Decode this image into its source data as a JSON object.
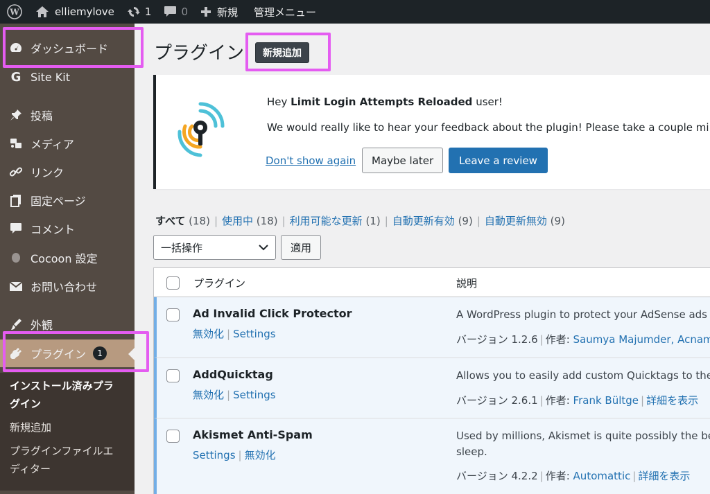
{
  "adminbar": {
    "site_name": "elliemylove",
    "updates_count": "1",
    "comments_count": "0",
    "new_label": "新規",
    "admin_menu_label": "管理メニュー"
  },
  "sidebar": {
    "items": [
      {
        "label": "ダッシュボード",
        "icon": "dashboard-icon"
      },
      {
        "label": "Site Kit",
        "icon": "google-g-icon"
      },
      {
        "label": "投稿",
        "icon": "pin-icon"
      },
      {
        "label": "メディア",
        "icon": "media-icon"
      },
      {
        "label": "リンク",
        "icon": "link-icon"
      },
      {
        "label": "固定ページ",
        "icon": "pages-icon"
      },
      {
        "label": "コメント",
        "icon": "comment-icon"
      },
      {
        "label": "Cocoon 設定",
        "icon": "circle-icon"
      },
      {
        "label": "お問い合わせ",
        "icon": "mail-icon"
      },
      {
        "label": "外観",
        "icon": "brush-icon"
      },
      {
        "label": "プラグイン",
        "icon": "plugin-icon",
        "badge": "1"
      }
    ],
    "submenu": {
      "installed_line1": "インストール済みプラ",
      "installed_line2": "グイン",
      "add_new": "新規追加",
      "editor_line1": "プラグインファイルエ",
      "editor_line2": "ディター"
    }
  },
  "main": {
    "title": "プラグイン",
    "add_new_button": "新規追加"
  },
  "notice": {
    "greeting_pre": "Hey ",
    "plugin_name": "Limit Login Attempts Reloaded",
    "greeting_post": " user!",
    "message": "We would really like to hear your feedback about the plugin! Please take a couple minute",
    "dont_show": "Don't show again",
    "maybe_later": "Maybe later",
    "leave_review": "Leave a review"
  },
  "filters": {
    "all": "すべて",
    "all_count": "(18)",
    "active": "使用中",
    "active_count": "(18)",
    "updates": "利用可能な更新",
    "updates_count": "(1)",
    "auto_on": "自動更新有効",
    "auto_on_count": "(9)",
    "auto_off": "自動更新無効",
    "auto_off_count": "(9)",
    "sep": "|"
  },
  "bulk": {
    "select_value": "一括操作",
    "apply": "適用"
  },
  "table": {
    "col_plugin": "プラグイン",
    "col_desc": "説明",
    "rows": [
      {
        "name": "Ad Invalid Click Protector",
        "action1": "無効化",
        "action2": "Settings",
        "desc1": "A WordPress plugin to protect your AdSense ads f",
        "version": "バージョン 1.2.6",
        "author_label": "作者:",
        "author": "Saumya Majumder, Acnam"
      },
      {
        "name": "AddQuicktag",
        "action1": "無効化",
        "action2": "Settings",
        "desc1": "Allows you to easily add custom Quicktags to the h",
        "version": "バージョン 2.6.1",
        "author_label": "作者:",
        "author": "Frank Bültge",
        "details": "詳細を表示"
      },
      {
        "name": "Akismet Anti-Spam",
        "action1": "Settings",
        "action2": "無効化",
        "desc1": "Used by millions, Akismet is quite possibly the bes",
        "desc2": "sleep.",
        "version": "バージョン 4.2.2",
        "author_label": "作者:",
        "author": "Automattic",
        "details": "詳細を表示"
      }
    ]
  },
  "colors": {
    "sidebar_bg": "#534a43",
    "sidebar_current": "#b79a80",
    "highlight": "#e45cf1",
    "link": "#2271b1",
    "primary_button": "#2271b1"
  }
}
